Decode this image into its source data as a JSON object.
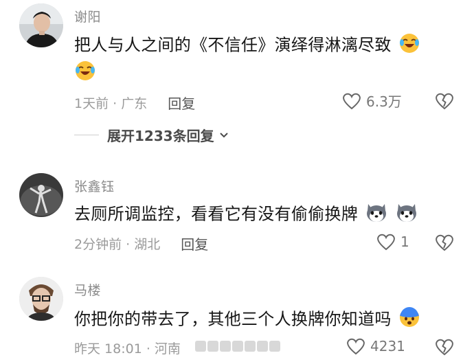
{
  "comments": [
    {
      "username": "谢阳",
      "line1": "把人与人之间的《不信任》演绎得淋漓尽致",
      "emoji": "laugh-crying-emoji",
      "meta": "1天前 · 广东",
      "reply_label": "回复",
      "likes": "6.3万",
      "expand_label": "展开1233条回复"
    },
    {
      "username": "张鑫钰",
      "line1": "去厕所调监控，看看它有没有偷偷换牌",
      "emoji": "husky-dog-emoji",
      "meta": "2分钟前 · 湖北",
      "reply_label": "回复",
      "likes": "1"
    },
    {
      "username": "马楼",
      "line1": "你把你的带去了，其他三个人换牌你知道吗",
      "emoji": "fearful-face-emoji",
      "meta": "昨天 18:01 · 河南",
      "likes": "4231"
    }
  ],
  "colors": {
    "text": "#161616",
    "meta": "#9a9a9a",
    "username": "#8a8a8a"
  }
}
